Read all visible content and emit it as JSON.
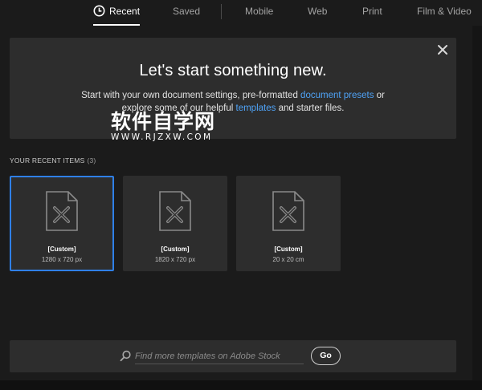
{
  "tabs": [
    {
      "label": "Recent",
      "active": true,
      "icon": "clock-icon"
    },
    {
      "label": "Saved"
    },
    {
      "label": "Mobile"
    },
    {
      "label": "Web"
    },
    {
      "label": "Print"
    },
    {
      "label": "Film & Video"
    }
  ],
  "hero": {
    "title": "Let's start something new.",
    "line1_before": "Start with your own document settings, pre-formatted ",
    "line1_link": "document presets",
    "line1_after": " or",
    "line2_before": "explore some of our helpful ",
    "line2_link": "templates",
    "line2_after": " and starter files.",
    "close_icon": "close-icon"
  },
  "watermark": {
    "main": "软件自学网",
    "sub": "WWW.RJZXW.COM"
  },
  "recent": {
    "header": "YOUR RECENT ITEMS",
    "count": "(3)",
    "items": [
      {
        "name": "[Custom]",
        "size": "1280 x 720 px",
        "selected": true,
        "icon": "document-icon"
      },
      {
        "name": "[Custom]",
        "size": "1820 x 720 px",
        "selected": false,
        "icon": "document-icon"
      },
      {
        "name": "[Custom]",
        "size": "20 x 20 cm",
        "selected": false,
        "icon": "document-icon"
      }
    ]
  },
  "search": {
    "placeholder": "Find more templates on Adobe Stock",
    "value": "",
    "go_label": "Go",
    "icon": "search-icon"
  },
  "colors": {
    "background": "#1b1b1b",
    "panel": "#2d2d2d",
    "accent": "#2f80e8",
    "link": "#4fa3f7"
  }
}
